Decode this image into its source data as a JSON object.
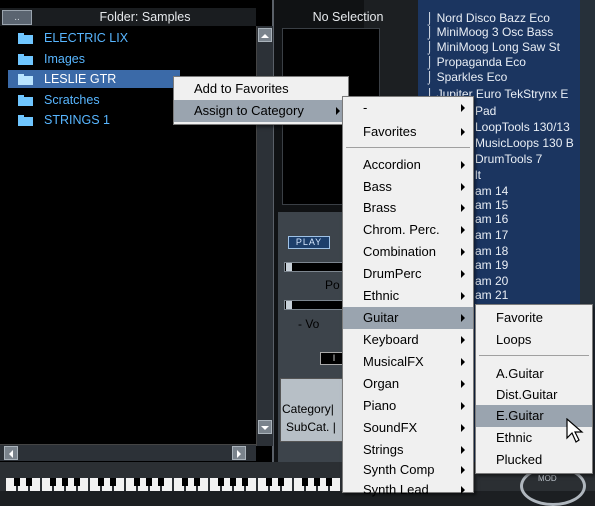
{
  "browser": {
    "header_button": "..",
    "folder_title": "Folder: Samples",
    "items": [
      {
        "label": "ELECTRIC LIX"
      },
      {
        "label": "Images"
      },
      {
        "label": "LESLIE GTR"
      },
      {
        "label": "Scratches"
      },
      {
        "label": "STRINGS 1"
      }
    ]
  },
  "center": {
    "no_selection": "No Selection",
    "play_label": "PLAY",
    "label_po": "Po",
    "label_vo": "- Vo",
    "category_label": "Category|",
    "subcat_label": "SubCat. |",
    "label_i": "I"
  },
  "rightlist": {
    "items": [
      "⌡ Nord Disco Bazz  Eco",
      "⌡ MiniMoog 3 Osc Bass",
      "⌡ MiniMoog Long Saw  St",
      "⌡ Propaganda  Eco",
      "⌡ Sparkles Eco",
      "⌡ Jupiter Euro TekStrynx E",
      "Pad",
      "LoopTools 130/13",
      "MusicLoops 130 B",
      "DrumTools 7",
      "lt",
      "am 14",
      "am 15",
      "am 16",
      "am 17",
      "am 18",
      "am 19",
      "am 20",
      "am 21"
    ],
    "bottom_label": "MOD"
  },
  "context_menu": {
    "items": [
      "Add to Favorites",
      "Assign to Category"
    ]
  },
  "category_menu": {
    "items": [
      "-",
      "Favorites",
      "Accordion",
      "Bass",
      "Brass",
      "Chrom. Perc.",
      "Combination",
      "DrumPerc",
      "Ethnic",
      "Guitar",
      "Keyboard",
      "MusicalFX",
      "Organ",
      "Piano",
      "SoundFX",
      "Strings",
      "Synth Comp",
      "Synth Lead"
    ]
  },
  "guitar_menu": {
    "items": [
      "Favorite",
      "Loops",
      "A.Guitar",
      "Dist.Guitar",
      "E.Guitar",
      "Ethnic",
      "Plucked"
    ]
  },
  "colors": {
    "accent": "#58b6ff",
    "selection": "#3b6aa8",
    "menu_highlight": "#9aa4af",
    "right_panel": "#1b3560"
  }
}
